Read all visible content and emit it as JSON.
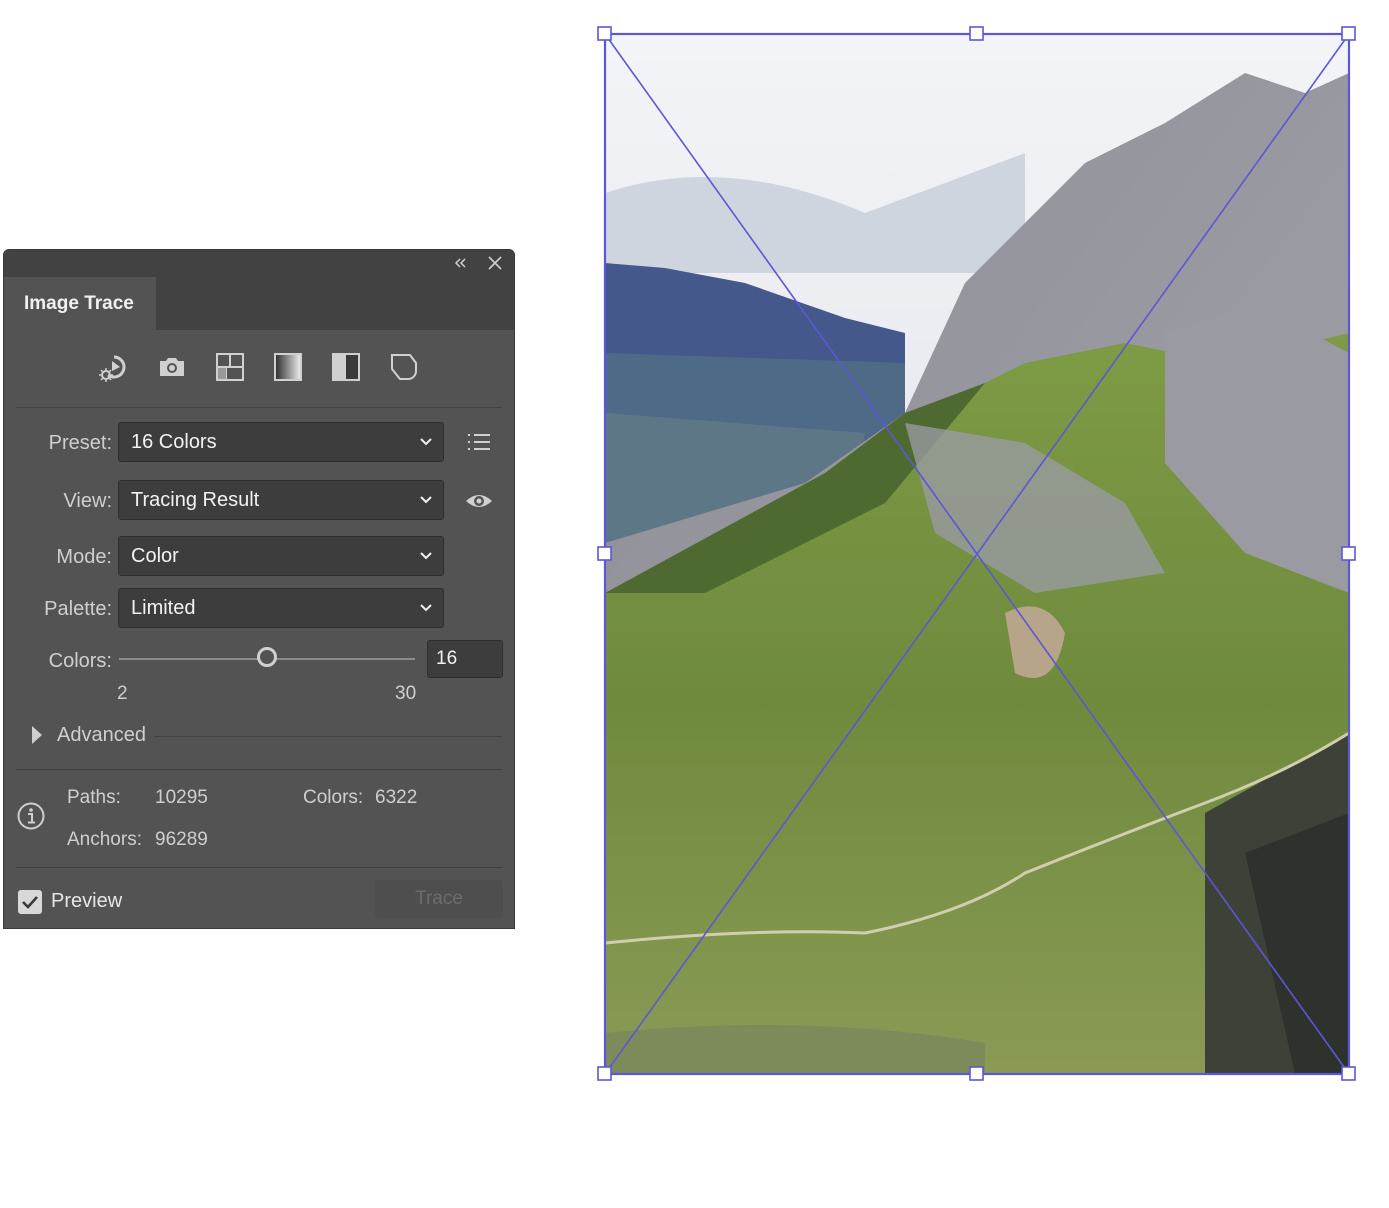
{
  "panel": {
    "title": "Image Trace",
    "preset": {
      "label": "Preset:",
      "value": "16 Colors"
    },
    "view": {
      "label": "View:",
      "value": "Tracing Result"
    },
    "mode": {
      "label": "Mode:",
      "value": "Color"
    },
    "palette": {
      "label": "Palette:",
      "value": "Limited"
    },
    "colors": {
      "label": "Colors:",
      "value": "16",
      "min": "2",
      "max": "30",
      "slider_fraction": 0.5
    },
    "advanced": "Advanced",
    "stats": {
      "paths_label": "Paths:",
      "paths": "10295",
      "colors_label": "Colors:",
      "colors": "6322",
      "anchors_label": "Anchors:",
      "anchors": "96289"
    },
    "preview": {
      "label": "Preview",
      "checked": true
    },
    "trace_button": "Trace",
    "preset_icons": [
      "auto-color-icon",
      "high-color-icon",
      "low-color-icon",
      "grayscale-icon",
      "black-and-white-icon",
      "outline-icon"
    ]
  },
  "selection": {
    "color": "#5b57d6"
  }
}
